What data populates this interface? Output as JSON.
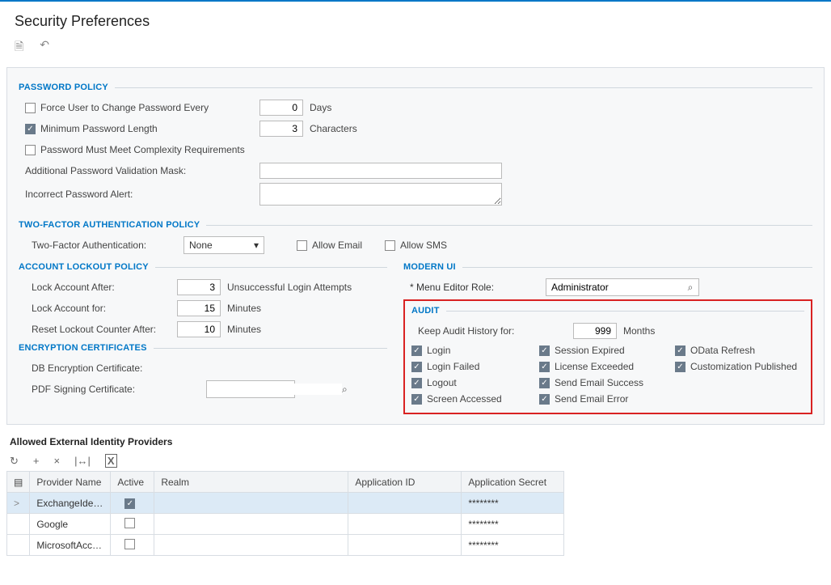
{
  "pageTitle": "Security Preferences",
  "sections": {
    "passwordPolicy": "PASSWORD POLICY",
    "twoFactorPolicy": "TWO-FACTOR AUTHENTICATION POLICY",
    "accountLockout": "ACCOUNT LOCKOUT POLICY",
    "encryptionCerts": "ENCRYPTION CERTIFICATES",
    "modernUi": "MODERN UI",
    "audit": "AUDIT"
  },
  "password": {
    "forceChangeLabel": "Force User to Change Password Every",
    "forceChangeChecked": false,
    "forceChangeValue": "0",
    "forceChangeUnit": "Days",
    "minLengthLabel": "Minimum Password Length",
    "minLengthChecked": true,
    "minLengthValue": "3",
    "minLengthUnit": "Characters",
    "complexityLabel": "Password Must Meet Complexity Requirements",
    "complexityChecked": false,
    "validationMaskLabel": "Additional Password Validation Mask:",
    "validationMaskValue": "",
    "incorrectAlertLabel": "Incorrect Password Alert:",
    "incorrectAlertValue": ""
  },
  "twoFactor": {
    "tfaLabel": "Two-Factor Authentication:",
    "tfaValue": "None",
    "allowEmailLabel": "Allow Email",
    "allowEmailChecked": false,
    "allowSmsLabel": "Allow SMS",
    "allowSmsChecked": false
  },
  "lockout": {
    "lockAfterLabel": "Lock Account After:",
    "lockAfterValue": "3",
    "lockAfterUnit": "Unsuccessful Login Attempts",
    "lockForLabel": "Lock Account for:",
    "lockForValue": "15",
    "lockForUnit": "Minutes",
    "resetCounterLabel": "Reset Lockout Counter After:",
    "resetCounterValue": "10",
    "resetCounterUnit": "Minutes"
  },
  "encryption": {
    "dbCertLabel": "DB Encryption Certificate:",
    "pdfCertLabel": "PDF Signing Certificate:",
    "pdfCertValue": ""
  },
  "modernUi": {
    "menuEditorRoleLabel": "* Menu Editor Role:",
    "menuEditorRoleValue": "Administrator"
  },
  "audit": {
    "keepHistoryLabel": "Keep Audit History for:",
    "keepHistoryValue": "999",
    "keepHistoryUnit": "Months",
    "items": [
      {
        "label": "Login",
        "checked": true
      },
      {
        "label": "Session Expired",
        "checked": true
      },
      {
        "label": "OData Refresh",
        "checked": true
      },
      {
        "label": "Login Failed",
        "checked": true
      },
      {
        "label": "License Exceeded",
        "checked": true
      },
      {
        "label": "Customization Published",
        "checked": true
      },
      {
        "label": "Logout",
        "checked": true
      },
      {
        "label": "Send Email Success",
        "checked": true
      },
      {
        "label": "",
        "checked": false
      },
      {
        "label": "Screen Accessed",
        "checked": true
      },
      {
        "label": "Send Email Error",
        "checked": true
      },
      {
        "label": "",
        "checked": false
      }
    ]
  },
  "providers": {
    "title": "Allowed External Identity Providers",
    "columns": {
      "providerName": "Provider Name",
      "active": "Active",
      "realm": "Realm",
      "appId": "Application ID",
      "appSecret": "Application Secret"
    },
    "rows": [
      {
        "name": "ExchangeIde…",
        "active": true,
        "realm": "",
        "appId": "",
        "secret": "********",
        "selected": true
      },
      {
        "name": "Google",
        "active": false,
        "realm": "",
        "appId": "",
        "secret": "********",
        "selected": false
      },
      {
        "name": "MicrosoftAcc…",
        "active": false,
        "realm": "",
        "appId": "",
        "secret": "********",
        "selected": false
      }
    ]
  }
}
